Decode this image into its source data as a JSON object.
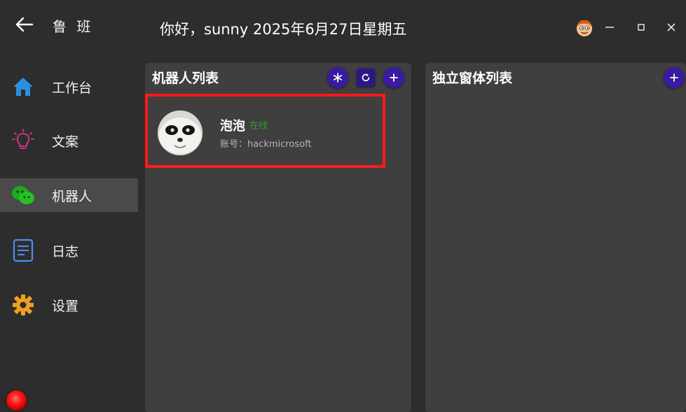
{
  "header": {
    "app_title": "鲁 班",
    "greeting": "你好，sunny 2025年6月27日星期五"
  },
  "sidebar": {
    "items": [
      {
        "label": "工作台",
        "icon": "home-icon"
      },
      {
        "label": "文案",
        "icon": "lightbulb-icon"
      },
      {
        "label": "机器人",
        "icon": "wechat-icon",
        "active": true
      },
      {
        "label": "日志",
        "icon": "document-icon"
      },
      {
        "label": "设置",
        "icon": "gear-icon"
      }
    ]
  },
  "robots_panel": {
    "title": "机器人列表",
    "robots": [
      {
        "name": "泡泡",
        "status": "在线",
        "account": "账号：hackmicrosoft"
      }
    ]
  },
  "windows_panel": {
    "title": "独立窗体列表"
  },
  "colors": {
    "background": "#2d2d2d",
    "panel": "#3f3f3f",
    "button": "#3a1a9e",
    "online": "#2e9e2e",
    "highlight": "#ff1a1a",
    "status_dot": "#ff1a1a"
  }
}
